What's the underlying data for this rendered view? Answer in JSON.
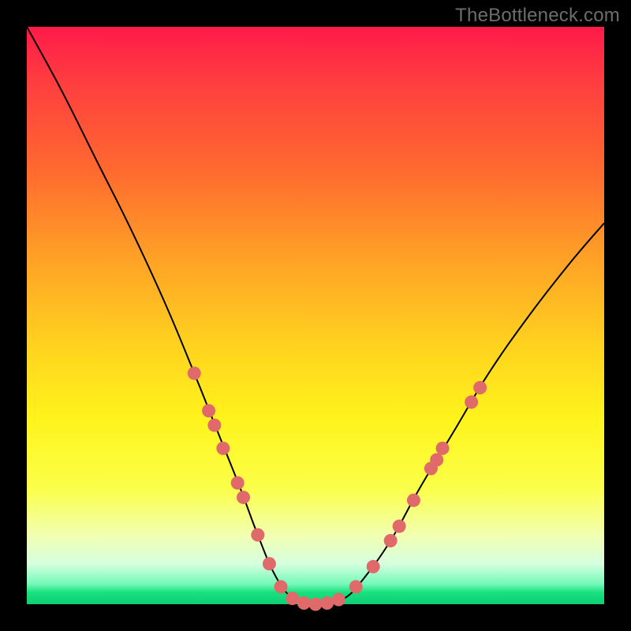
{
  "watermark": "TheBottleneck.com",
  "colors": {
    "background": "#000000",
    "curve_stroke": "#000000",
    "marker_fill": "#e06a6a",
    "gradient_top": "#ff1a49",
    "gradient_bottom": "#0fcf76"
  },
  "chart_data": {
    "type": "line",
    "title": "",
    "xlabel": "",
    "ylabel": "",
    "xlim": [
      0,
      100
    ],
    "ylim": [
      0,
      100
    ],
    "grid": false,
    "legend": false,
    "annotations": [
      "TheBottleneck.com"
    ],
    "series": [
      {
        "name": "bottleneck-curve",
        "x": [
          0,
          6,
          12,
          18,
          24,
          29,
          33,
          37,
          40,
          43,
          46,
          49,
          52,
          55,
          58,
          63,
          68,
          74,
          80,
          87,
          94,
          100
        ],
        "values": [
          100,
          89,
          77,
          65,
          52,
          40,
          30,
          20,
          12,
          5,
          1,
          0,
          0,
          1,
          4,
          11,
          20,
          30,
          40,
          50,
          59,
          66
        ]
      }
    ],
    "markers": [
      {
        "x": 29.0,
        "y": 40.0
      },
      {
        "x": 31.5,
        "y": 33.5
      },
      {
        "x": 32.5,
        "y": 31.0
      },
      {
        "x": 34.0,
        "y": 27.0
      },
      {
        "x": 36.5,
        "y": 21.0
      },
      {
        "x": 37.5,
        "y": 18.5
      },
      {
        "x": 40.0,
        "y": 12.0
      },
      {
        "x": 42.0,
        "y": 7.0
      },
      {
        "x": 44.0,
        "y": 3.0
      },
      {
        "x": 46.0,
        "y": 1.0
      },
      {
        "x": 48.0,
        "y": 0.2
      },
      {
        "x": 50.0,
        "y": 0.0
      },
      {
        "x": 52.0,
        "y": 0.2
      },
      {
        "x": 54.0,
        "y": 0.8
      },
      {
        "x": 57.0,
        "y": 3.0
      },
      {
        "x": 60.0,
        "y": 6.5
      },
      {
        "x": 63.0,
        "y": 11.0
      },
      {
        "x": 64.5,
        "y": 13.5
      },
      {
        "x": 67.0,
        "y": 18.0
      },
      {
        "x": 70.0,
        "y": 23.5
      },
      {
        "x": 71.0,
        "y": 25.0
      },
      {
        "x": 72.0,
        "y": 27.0
      },
      {
        "x": 77.0,
        "y": 35.0
      },
      {
        "x": 78.5,
        "y": 37.5
      }
    ]
  }
}
